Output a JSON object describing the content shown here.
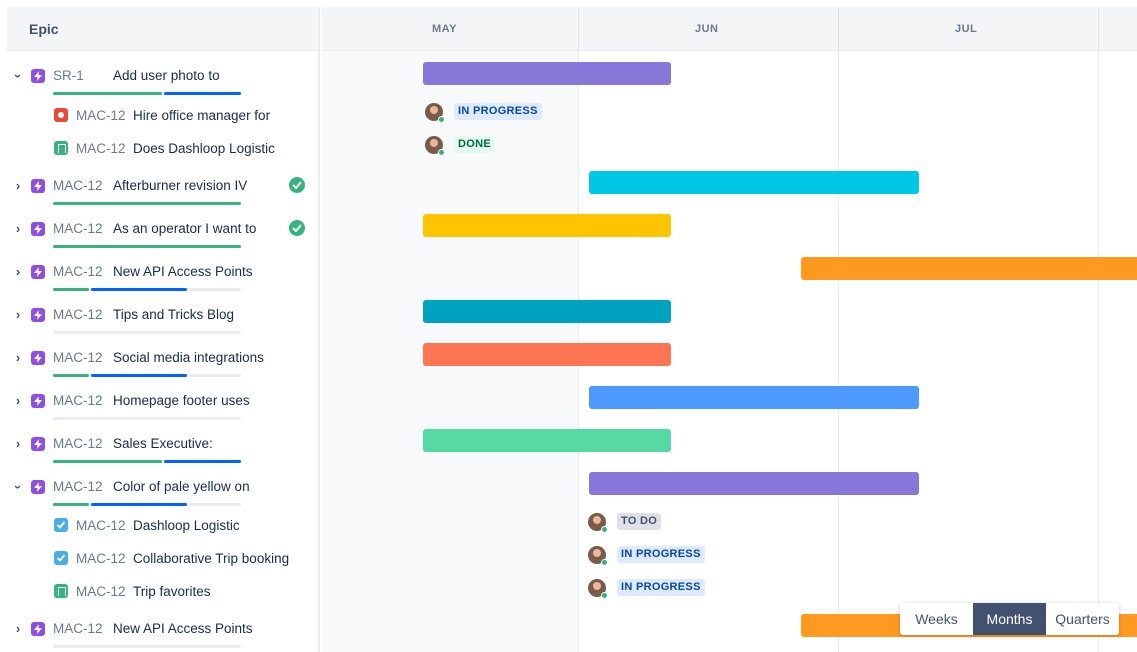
{
  "table": {
    "epic_header": "Epic",
    "rows": [
      {
        "key": "SR-1",
        "title": "Add user photo to"
      },
      {
        "key": "MAC-12",
        "title": "Hire office manager for"
      },
      {
        "key": "MAC-12",
        "title": "Does Dashloop Logistic"
      },
      {
        "key": "MAC-12",
        "title": "Afterburner revision IV"
      },
      {
        "key": "MAC-12",
        "title": "As an operator I want to"
      },
      {
        "key": "MAC-12",
        "title": "New API Access Points"
      },
      {
        "key": "MAC-12",
        "title": "Tips and Tricks Blog"
      },
      {
        "key": "MAC-12",
        "title": "Social media integrations"
      },
      {
        "key": "MAC-12",
        "title": "Homepage footer uses"
      },
      {
        "key": "MAC-12",
        "title": "Sales Executive:"
      },
      {
        "key": "MAC-12",
        "title": "Color of pale yellow on"
      },
      {
        "key": "MAC-12",
        "title": "Dashloop Logistic"
      },
      {
        "key": "MAC-12",
        "title": "Collaborative Trip booking"
      },
      {
        "key": "MAC-12",
        "title": "Trip favorites"
      },
      {
        "key": "MAC-12",
        "title": "New API Access Points"
      }
    ]
  },
  "timeline": {
    "months": [
      "MAY",
      "JUN",
      "JUL"
    ]
  },
  "statuses": {
    "in_progress": "IN PROGRESS",
    "done": "DONE",
    "to_do": "TO DO"
  },
  "view_switcher": {
    "options": [
      "Weeks",
      "Months",
      "Quarters"
    ],
    "selected": "Months"
  },
  "colors": {
    "purple": "#8777d9",
    "cyan": "#00c7e6",
    "yellow": "#ffc400",
    "orange": "#ff991f",
    "teal": "#00a3bf",
    "red": "#ff7452",
    "blue": "#4c9aff",
    "green": "#57d9a3",
    "progress_green": "#36b37e",
    "progress_blue": "#0065ff",
    "epic_icon": "#904ee2"
  }
}
